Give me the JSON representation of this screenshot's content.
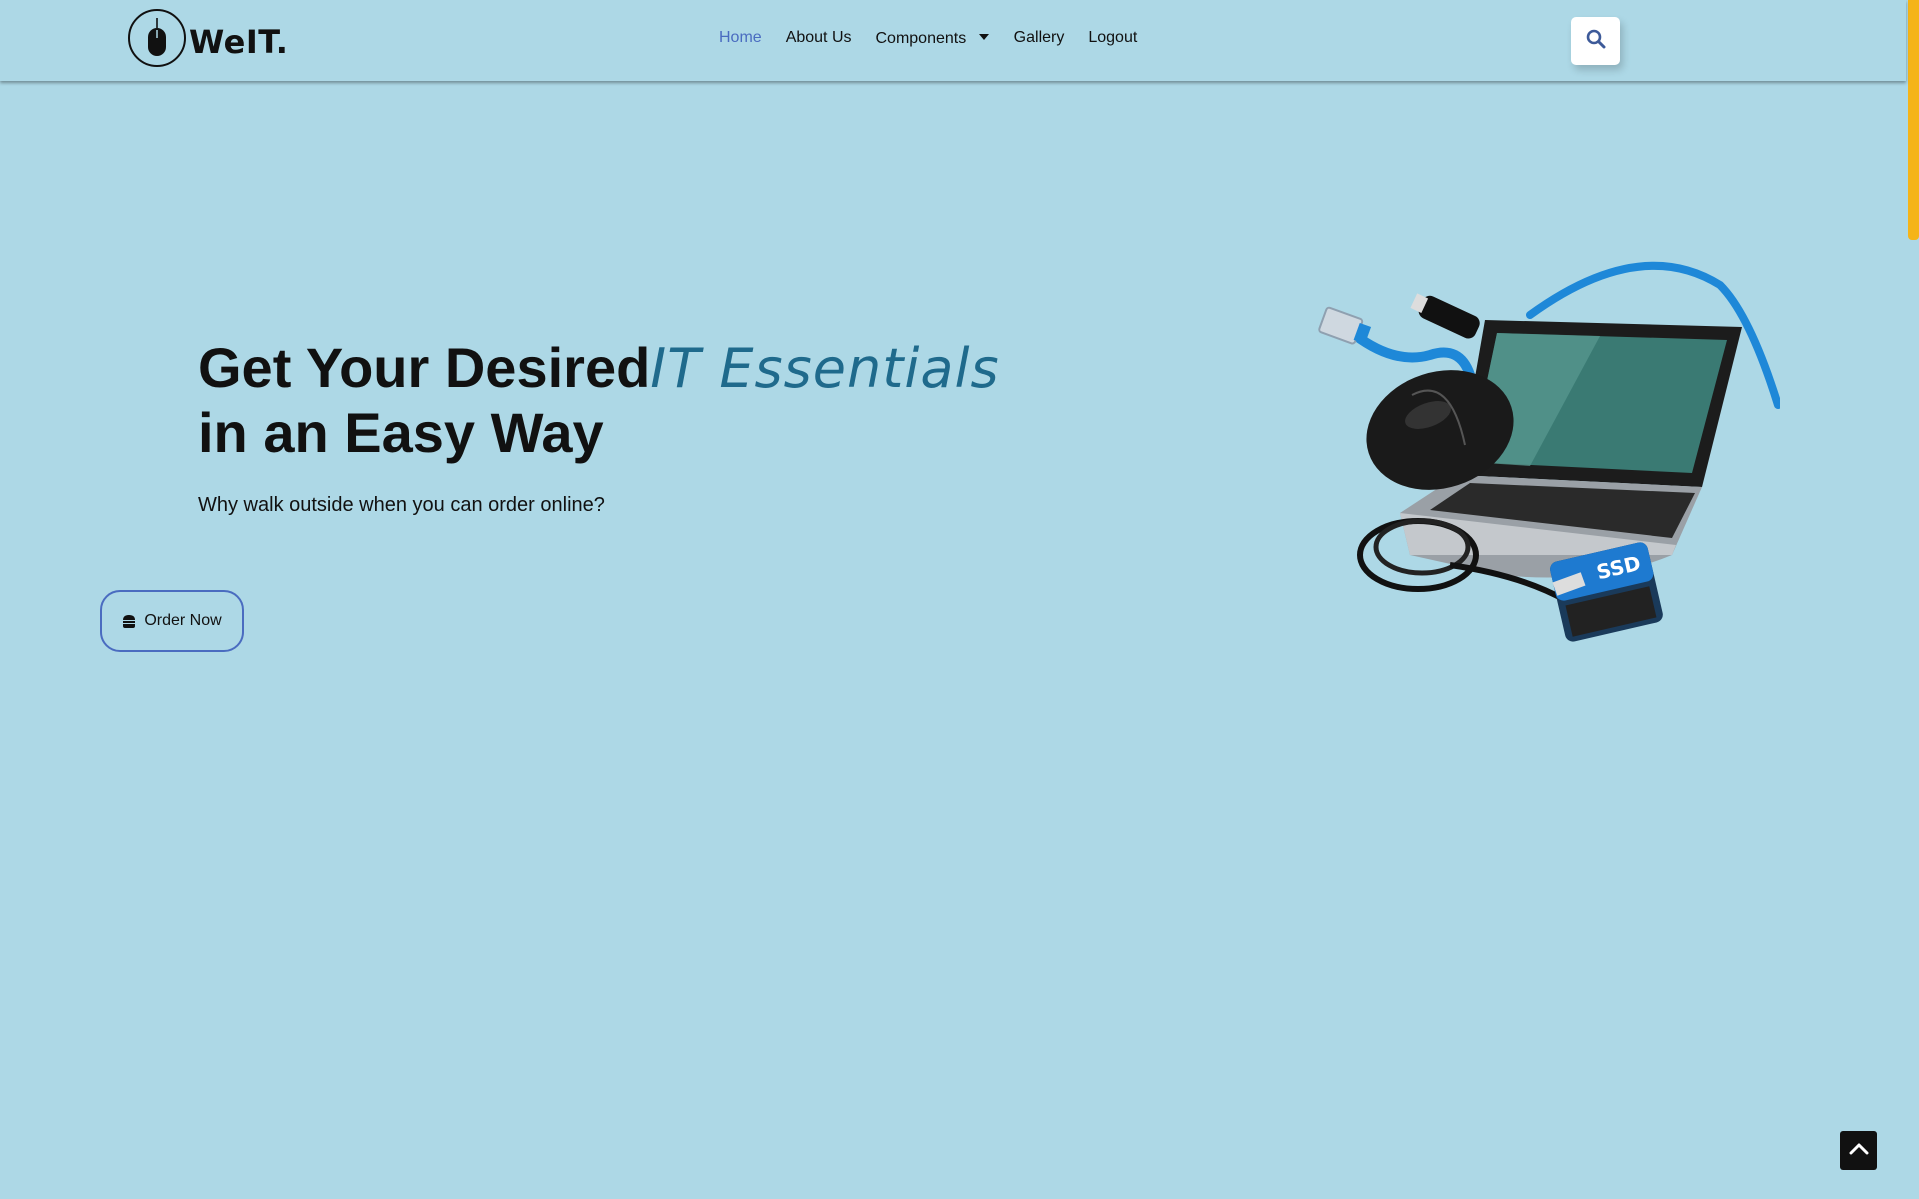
{
  "brand": {
    "name": "WeIT.",
    "logo_icon": "mouse-icon"
  },
  "nav": {
    "items": [
      {
        "label": "Home",
        "active": true
      },
      {
        "label": "About Us",
        "active": false
      },
      {
        "label": "Components",
        "active": false,
        "has_dropdown": true
      },
      {
        "label": "Gallery",
        "active": false
      },
      {
        "label": "Logout",
        "active": false
      }
    ],
    "search_icon": "search-icon"
  },
  "hero": {
    "title_lead": "Get Your Desired",
    "title_accent": "IT Essentials",
    "title_tail": "in an Easy Way",
    "subtitle": "Why walk outside when you can order online?",
    "cta_label": "Order Now",
    "cta_icon": "burger-icon",
    "image_icon": "it-essentials-illustration"
  },
  "scroll_top_icon": "chevron-up-icon",
  "colors": {
    "background": "#add8e6",
    "nav_active": "#4a6cc0",
    "accent_text": "#1f6a8c",
    "button_border": "#4a6cc0",
    "scroll_thumb": "#f5b418"
  }
}
